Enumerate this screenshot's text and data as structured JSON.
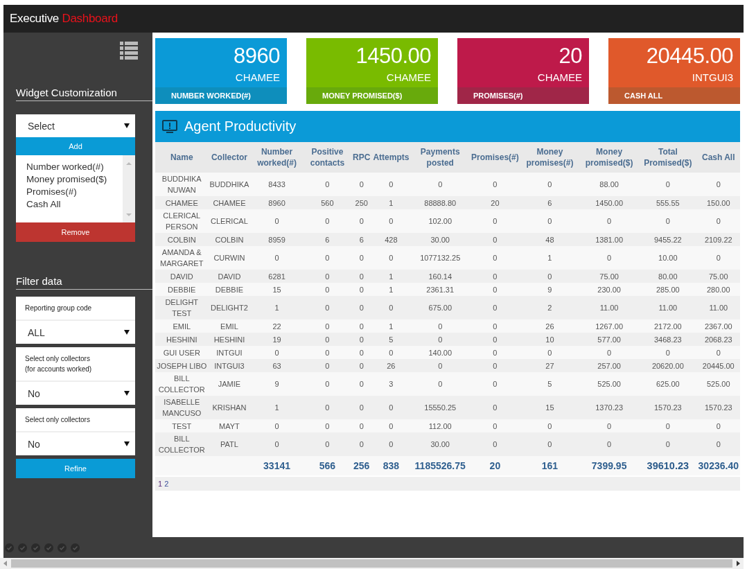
{
  "header": {
    "title": "Executive",
    "title_accent": "Dashboard"
  },
  "sidebar": {
    "widget_customization": {
      "heading": "Widget Customization",
      "select": {
        "value": "Select"
      },
      "add_button": "Add",
      "list_items": [
        "Number worked(#)",
        "Money promised($)",
        "Promises(#)",
        "Cash All"
      ],
      "remove_button": "Remove"
    },
    "filter": {
      "heading": "Filter data",
      "fields": [
        {
          "label": "Reporting group code",
          "value": "ALL"
        },
        {
          "label": "Select only collectors\n(for accounts worked)",
          "value": "No"
        },
        {
          "label": "Select only collectors",
          "value": "No"
        }
      ],
      "refine_button": "Refine"
    }
  },
  "kpi_cards": [
    {
      "value": "8960",
      "agent": "CHAMEE",
      "label": "NUMBER WORKED(#)",
      "color": "#0b9ad7"
    },
    {
      "value": "1450.00",
      "agent": "CHAMEE",
      "label": "MONEY PROMISED($)",
      "color": "#79bb00"
    },
    {
      "value": "20",
      "agent": "CHAMEE",
      "label": "PROMISES(#)",
      "color": "#be1a4a"
    },
    {
      "value": "20445.00",
      "agent": "INTGUI3",
      "label": "CASH ALL",
      "color": "#e0592b"
    }
  ],
  "panel": {
    "title": "Agent Productivity",
    "table": {
      "columns": [
        "Name",
        "Collector",
        "Number worked(#)",
        "Positive contacts",
        "RPC",
        "Attempts",
        "Payments posted",
        "Promises(#)",
        "Money promises(#)",
        "Money promised($)",
        "Total Promised($)",
        "Cash All"
      ],
      "rows": [
        [
          "BUDDHIKA NUWAN",
          "BUDDHIKA",
          "8433",
          "0",
          "0",
          "0",
          "0",
          "0",
          "0",
          "88.00",
          "0",
          "0"
        ],
        [
          "CHAMEE",
          "CHAMEE",
          "8960",
          "560",
          "250",
          "1",
          "88888.80",
          "20",
          "6",
          "1450.00",
          "555.55",
          "150.00"
        ],
        [
          "CLERICAL PERSON",
          "CLERICAL",
          "0",
          "0",
          "0",
          "0",
          "102.00",
          "0",
          "0",
          "0",
          "0",
          "0"
        ],
        [
          "COLBIN",
          "COLBIN",
          "8959",
          "6",
          "6",
          "428",
          "30.00",
          "0",
          "48",
          "1381.00",
          "9455.22",
          "2109.22"
        ],
        [
          "AMANDA & MARGARET",
          "CURWIN",
          "0",
          "0",
          "0",
          "0",
          "1077132.25",
          "0",
          "1",
          "0",
          "10.00",
          "0"
        ],
        [
          "DAVID",
          "DAVID",
          "6281",
          "0",
          "0",
          "1",
          "160.14",
          "0",
          "0",
          "75.00",
          "80.00",
          "75.00"
        ],
        [
          "DEBBIE",
          "DEBBIE",
          "15",
          "0",
          "0",
          "1",
          "2361.31",
          "0",
          "9",
          "230.00",
          "285.00",
          "280.00"
        ],
        [
          "DELIGHT TEST",
          "DELIGHT2",
          "1",
          "0",
          "0",
          "0",
          "675.00",
          "0",
          "2",
          "11.00",
          "11.00",
          "11.00"
        ],
        [
          "EMIL",
          "EMIL",
          "22",
          "0",
          "0",
          "1",
          "0",
          "0",
          "26",
          "1267.00",
          "2172.00",
          "2367.00"
        ],
        [
          "HESHINI",
          "HESHINI",
          "19",
          "0",
          "0",
          "5",
          "0",
          "0",
          "10",
          "577.00",
          "3468.23",
          "2068.23"
        ],
        [
          "GUI USER",
          "INTGUI",
          "0",
          "0",
          "0",
          "0",
          "140.00",
          "0",
          "0",
          "0",
          "0",
          "0"
        ],
        [
          "JOSEPH LIBO",
          "INTGUI3",
          "63",
          "0",
          "0",
          "26",
          "0",
          "0",
          "27",
          "257.00",
          "20620.00",
          "20445.00"
        ],
        [
          "BILL COLLECTOR",
          "JAMIE",
          "9",
          "0",
          "0",
          "3",
          "0",
          "0",
          "5",
          "525.00",
          "625.00",
          "525.00"
        ],
        [
          "ISABELLE MANCUSO",
          "KRISHAN",
          "1",
          "0",
          "0",
          "0",
          "15550.25",
          "0",
          "15",
          "1370.23",
          "1570.23",
          "1570.23"
        ],
        [
          "TEST",
          "MAYT",
          "0",
          "0",
          "0",
          "0",
          "112.00",
          "0",
          "0",
          "0",
          "0",
          "0"
        ],
        [
          "BILL COLLECTOR",
          "PATL",
          "0",
          "0",
          "0",
          "0",
          "30.00",
          "0",
          "0",
          "0",
          "0",
          "0"
        ]
      ],
      "totals": [
        "33141",
        "566",
        "256",
        "838",
        "1185526.75",
        "20",
        "161",
        "7399.95",
        "39610.23",
        "30236.40"
      ]
    },
    "pages": [
      "1",
      "2"
    ]
  }
}
